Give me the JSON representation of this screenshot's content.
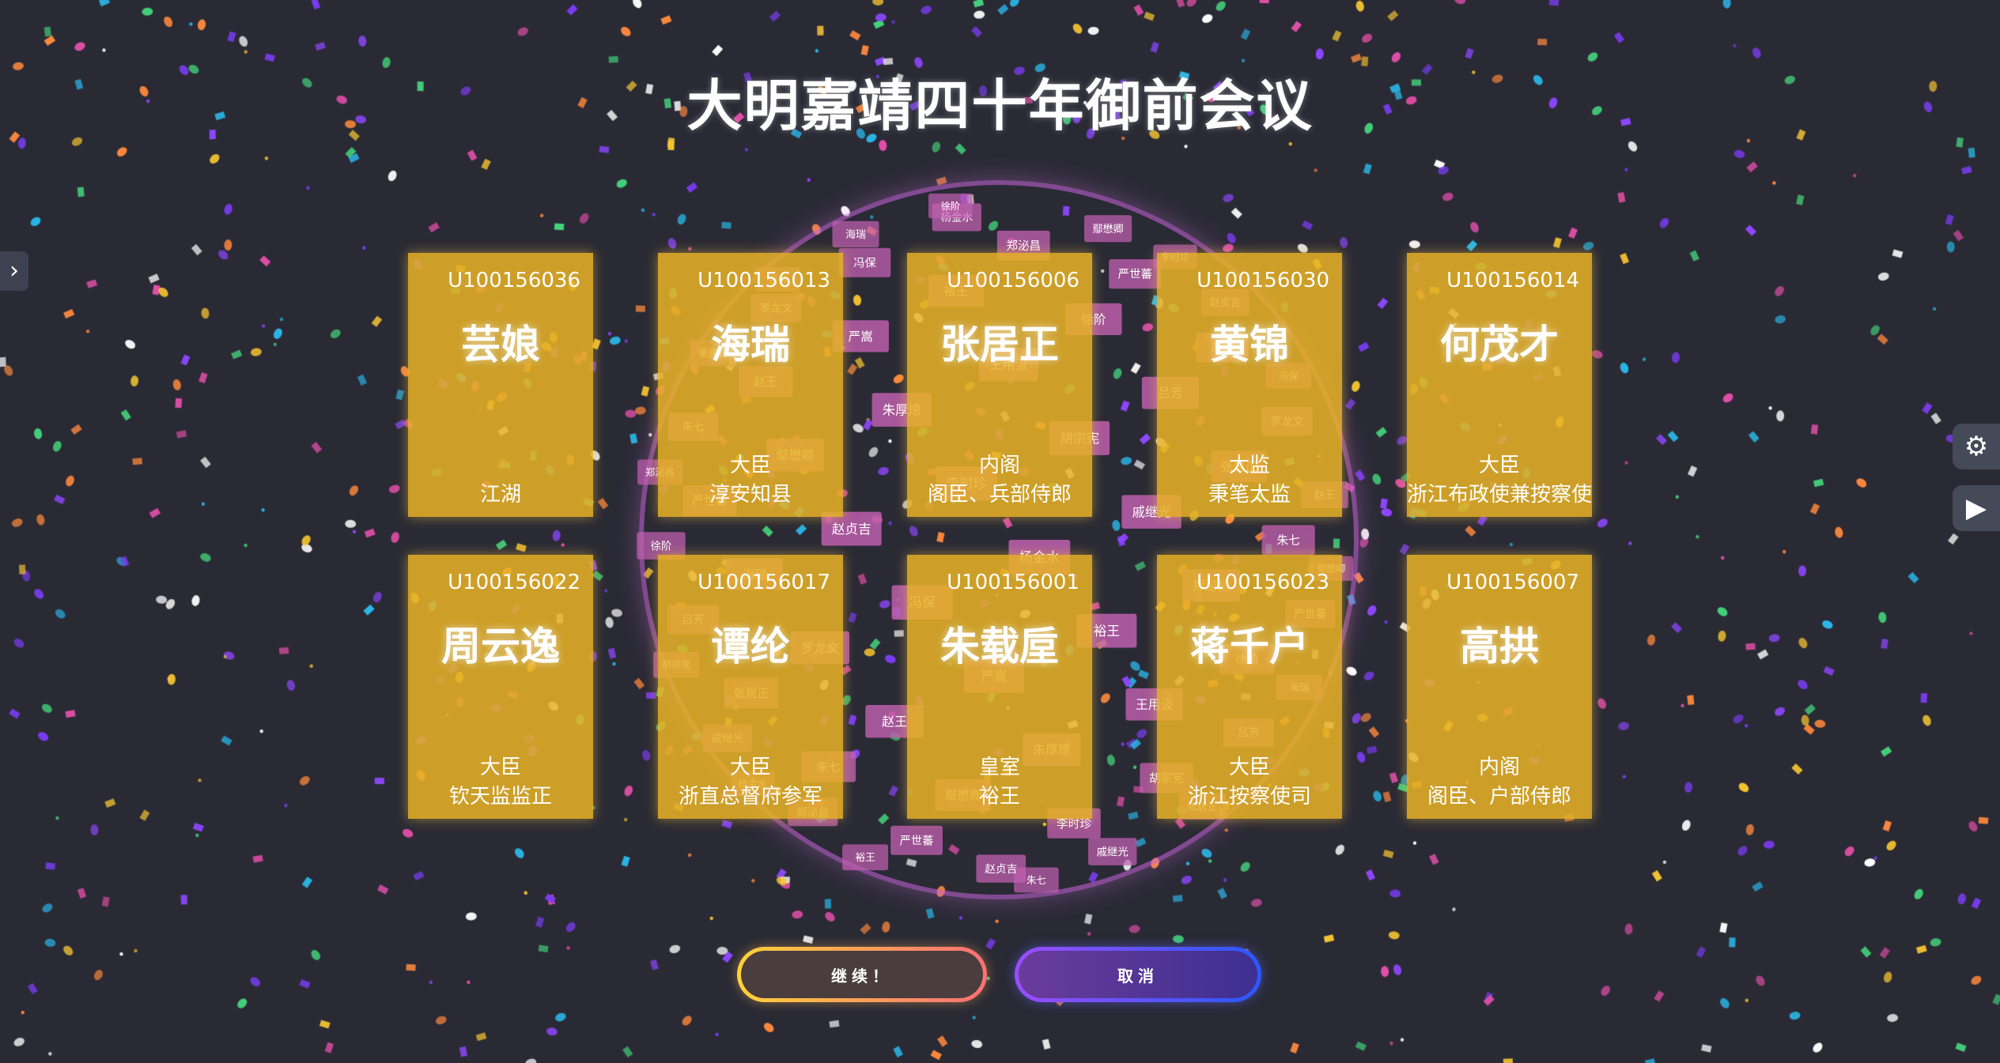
{
  "title": "大明嘉靖四十年御前会议",
  "cards": [
    {
      "id": "U100156036",
      "name": "芸娘",
      "role": "",
      "position": "江湖"
    },
    {
      "id": "U100156013",
      "name": "海瑞",
      "role": "大臣",
      "position": "淳安知县"
    },
    {
      "id": "U100156006",
      "name": "张居正",
      "role": "内阁",
      "position": "阁臣、兵部侍郎"
    },
    {
      "id": "U100156030",
      "name": "黄锦",
      "role": "太监",
      "position": "秉笔太监"
    },
    {
      "id": "U100156014",
      "name": "何茂才",
      "role": "大臣",
      "position": "浙江布政使兼按察使"
    },
    {
      "id": "U100156022",
      "name": "周云逸",
      "role": "大臣",
      "position": "钦天监监正"
    },
    {
      "id": "U100156017",
      "name": "谭纶",
      "role": "大臣",
      "position": "浙直总督府参军"
    },
    {
      "id": "U100156001",
      "name": "朱载垕",
      "role": "皇室",
      "position": "裕王"
    },
    {
      "id": "U100156023",
      "name": "蒋千户",
      "role": "大臣",
      "position": "浙江按察使司"
    },
    {
      "id": "U100156007",
      "name": "高拱",
      "role": "内阁",
      "position": "阁臣、户部侍郎"
    }
  ],
  "sphere_tags": [
    "朱七",
    "罗龙文",
    "赵贞吉",
    "朱厚熜",
    "裕王",
    "戚继光",
    "吕芳",
    "严世蕃",
    "赵王",
    "冯保",
    "李时珍",
    "王用汲",
    "郑泌昌",
    "张居正",
    "海瑞",
    "鄢懋卿",
    "严嵩",
    "杨金水",
    "胡宗宪",
    "徐阶"
  ],
  "buttons": {
    "continue": "继续！",
    "cancel": "取消"
  },
  "icons": {
    "left_toggle": "chevron-right-icon",
    "settings": "gear-icon",
    "play": "play-icon"
  },
  "colors": {
    "background": "#2a2a35",
    "card": "#e8b226",
    "sphere_tag": "#c060b0"
  }
}
